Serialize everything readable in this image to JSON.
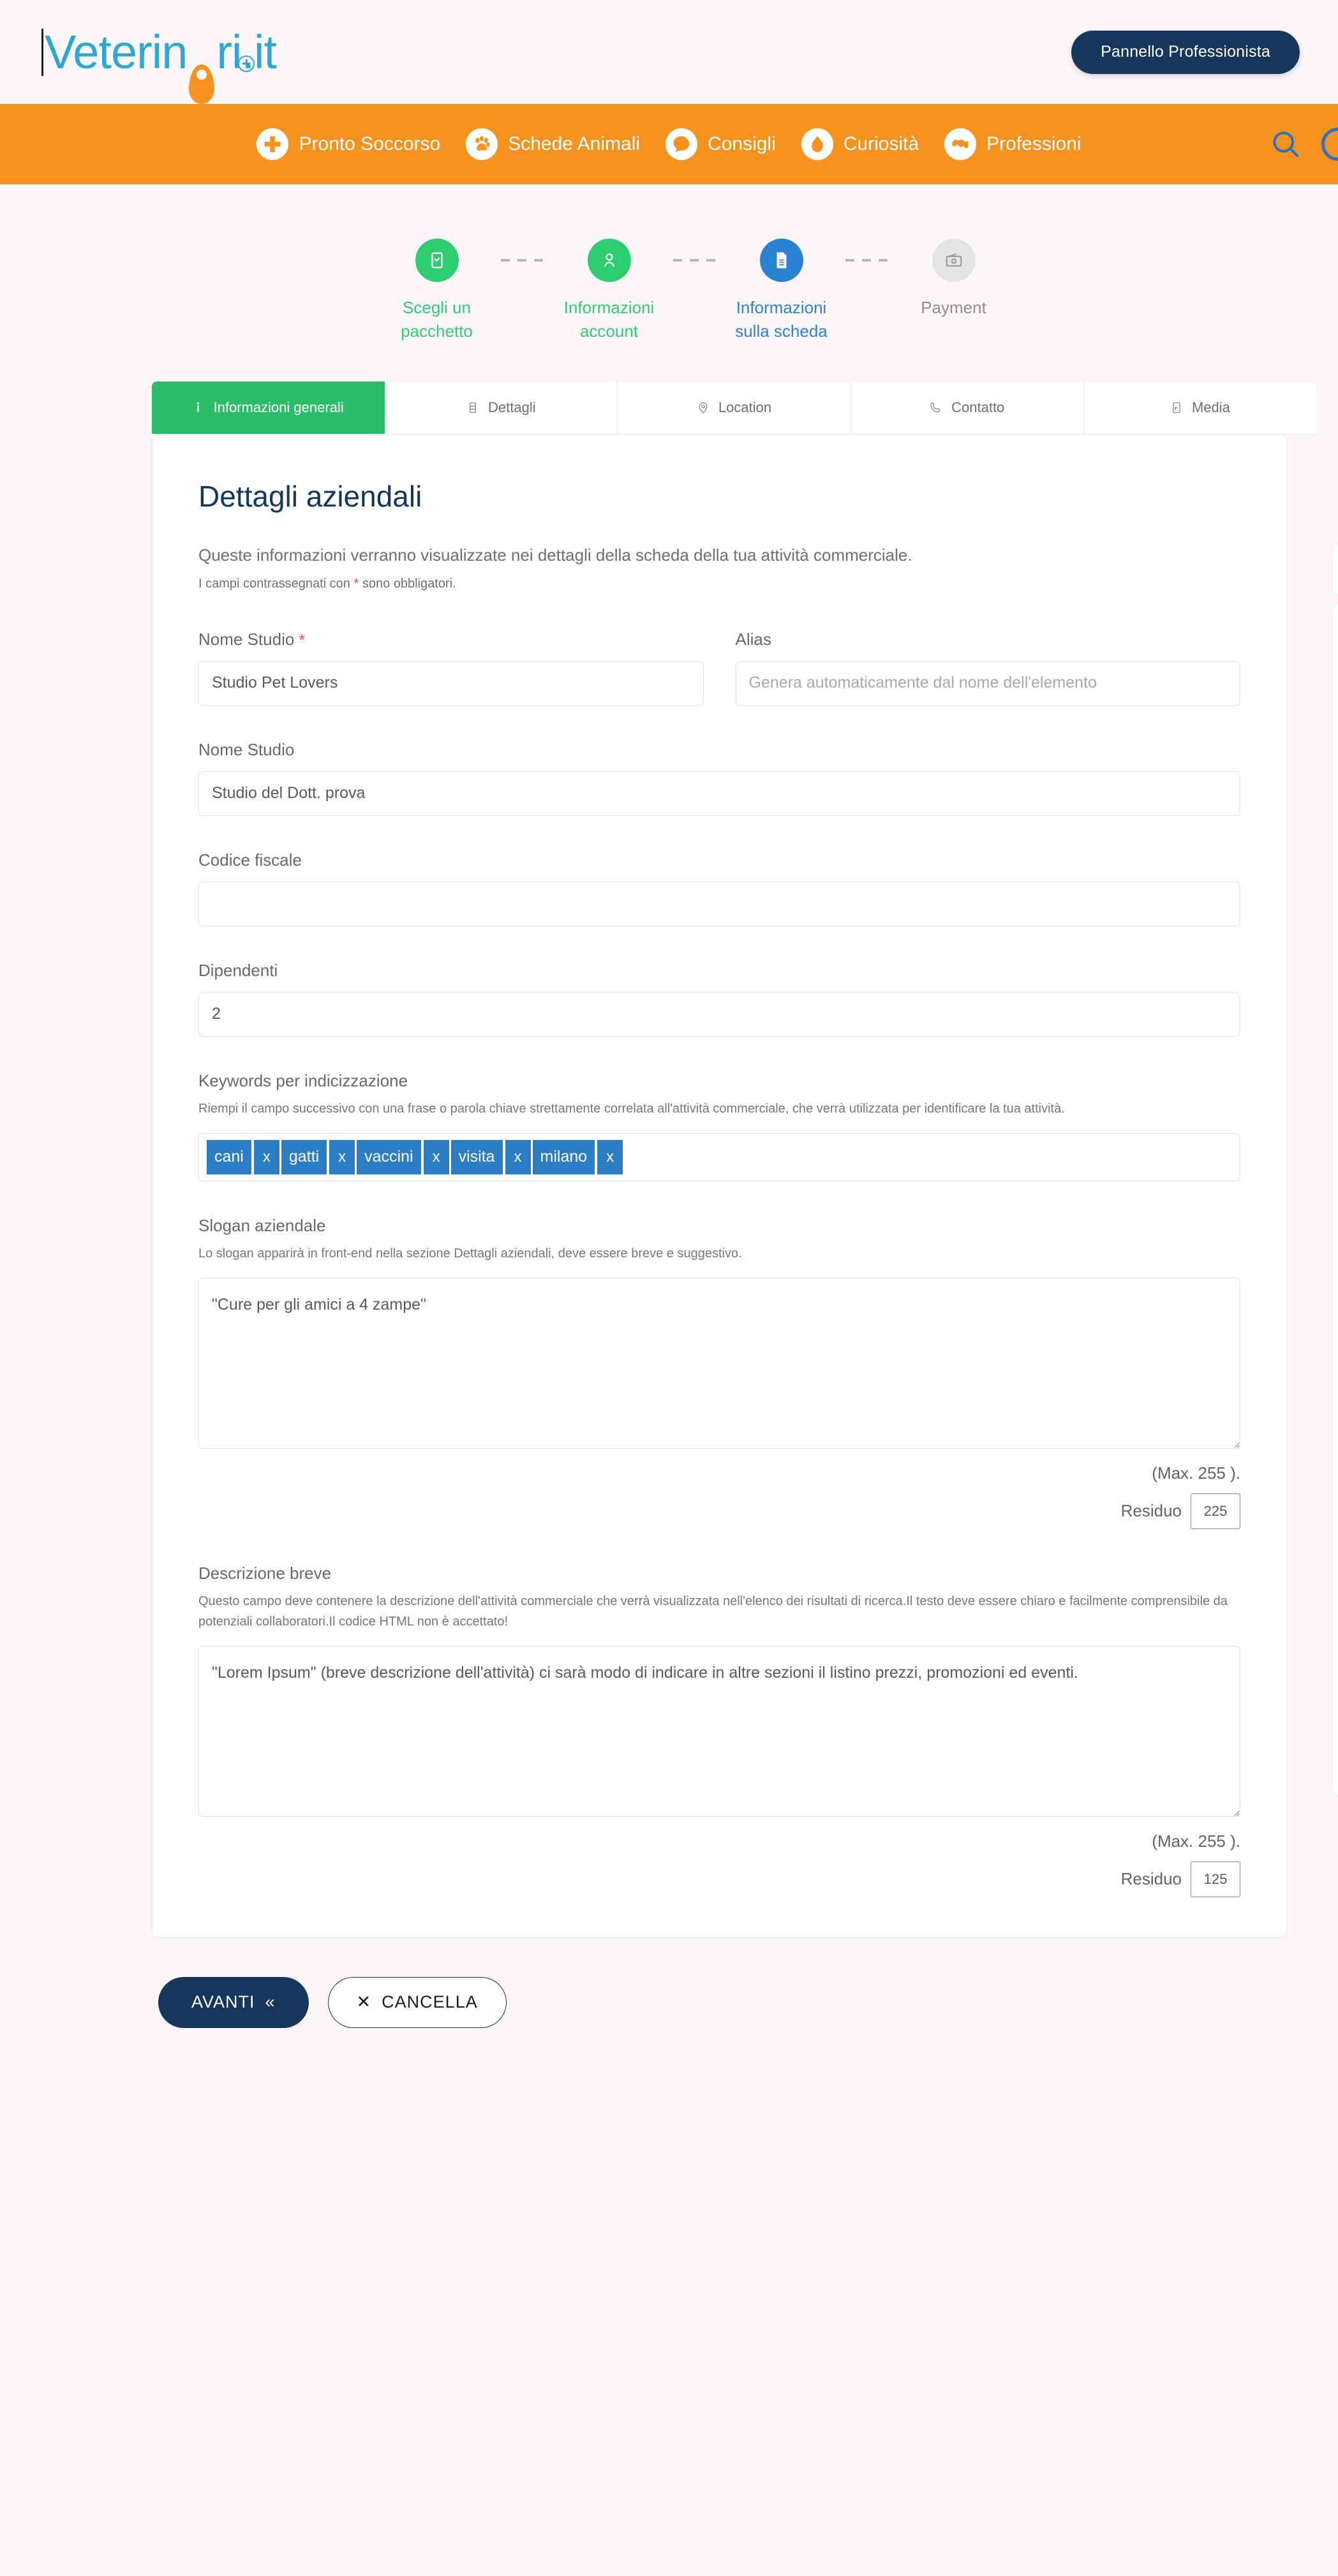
{
  "brand": {
    "logo_text_1": "Veterin",
    "logo_text_2": "ri",
    "logo_text_3": ".it",
    "accent_blue": "#2ca8d2",
    "accent_orange": "#f6921e",
    "navy": "#16365c",
    "green": "#2bbd67"
  },
  "topbar": {
    "panel_button": "Pannello Professionista"
  },
  "nav": {
    "items": [
      {
        "label": "Pronto Soccorso",
        "icon": "first-aid-cross-icon"
      },
      {
        "label": "Schede Animali",
        "icon": "paw-icon"
      },
      {
        "label": "Consigli",
        "icon": "speech-bubble-icon"
      },
      {
        "label": "Curiosità",
        "icon": "dog-head-icon"
      },
      {
        "label": "Professioni",
        "icon": "handshake-icon"
      }
    ],
    "search_icon": "search-icon",
    "trailing_icon": "circle-icon"
  },
  "stepper": {
    "steps": [
      {
        "label": "Scegli un pacchetto",
        "state": "complete",
        "color": "#2ecc71",
        "icon": "package-icon"
      },
      {
        "label": "Informazioni account",
        "state": "complete",
        "color": "#2ecc71",
        "icon": "user-icon"
      },
      {
        "label": "Informazioni sulla scheda",
        "state": "current",
        "color": "#2b82d4",
        "icon": "document-icon"
      },
      {
        "label": "Payment",
        "state": "pending",
        "color": "#e4e4e4",
        "icon": "payment-card-icon"
      }
    ]
  },
  "tabs": [
    {
      "label": "Informazioni generali",
      "icon": "info-icon",
      "active": true
    },
    {
      "label": "Dettagli",
      "icon": "list-icon",
      "active": false
    },
    {
      "label": "Location",
      "icon": "map-pin-icon",
      "active": false
    },
    {
      "label": "Contatto",
      "icon": "phone-icon",
      "active": false
    },
    {
      "label": "Media",
      "icon": "media-icon",
      "active": false
    }
  ],
  "form": {
    "title": "Dettagli aziendali",
    "intro": "Queste informazioni verranno visualizzate nei dettagli della scheda della tua attività commerciale.",
    "required_note_pre": "I campi contrassegnati con ",
    "required_note_star": "*",
    "required_note_post": " sono obbligatori.",
    "nome_studio_label": "Nome Studio",
    "nome_studio_required_star": "*",
    "nome_studio_value": "Studio Pet Lovers",
    "alias_label": "Alias",
    "alias_value": "",
    "alias_placeholder": "Genera automaticamente dal nome dell'elemento",
    "nome_studio2_label": "Nome Studio",
    "nome_studio2_value": "Studio del Dott. prova",
    "codice_fiscale_label": "Codice fiscale",
    "codice_fiscale_value": "",
    "dipendenti_label": "Dipendenti",
    "dipendenti_value": "2",
    "keywords_label": "Keywords per indicizzazione",
    "keywords_hint": "Riempi il campo successivo con una frase o parola chiave strettamente correlata all'attività commerciale, che verrà utilizzata per identificare la tua attività.",
    "keywords": [
      "cani",
      "gatti",
      "vaccini",
      "visita",
      "milano"
    ],
    "keyword_remove_glyph": "x",
    "slogan_label": "Slogan aziendale",
    "slogan_hint": "Lo slogan apparirà in front-end nella sezione Dettagli aziendali, deve essere breve e suggestivo.",
    "slogan_value": "\"Cure per gli amici a 4 zampe\"",
    "slogan_max_text": "(Max. 255 ).",
    "slogan_residuo_label": "Residuo",
    "slogan_residuo_value": "225",
    "descrizione_label": "Descrizione breve",
    "descrizione_hint": "Questo campo deve contenere la descrizione dell'attività commerciale che verrà visualizzata nell'elenco dei risultati di ricerca.Il testo deve essere chiaro e facilmente comprensibile da potenziali collaboratori.Il codice HTML non è accettato!",
    "descrizione_value": "\"Lorem Ipsum\" (breve descrizione dell'attività) ci sarà modo di indicare in altre sezioni il listino prezzi, promozioni ed eventi.",
    "descrizione_max_text": "(Max. 255 ).",
    "descrizione_residuo_label": "Residuo",
    "descrizione_residuo_value": "125"
  },
  "footer": {
    "next_label": "AVANTI",
    "next_glyph": "«",
    "cancel_glyph": "✕",
    "cancel_label": "CANCELLA"
  }
}
